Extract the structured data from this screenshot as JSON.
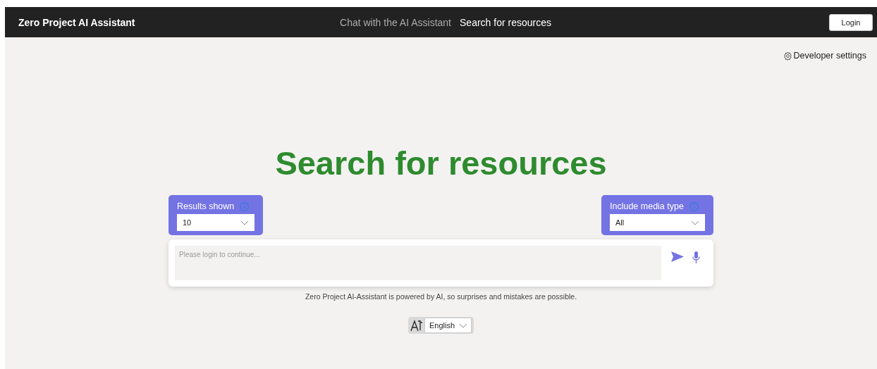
{
  "header": {
    "title": "Zero Project AI Assistant",
    "tabs": [
      {
        "label": "Chat with the AI Assistant",
        "selected": false
      },
      {
        "label": "Search for resources",
        "selected": true
      }
    ],
    "login_button": "Login"
  },
  "developer_settings": "Developer settings",
  "heading": "Search for resources",
  "filters": [
    {
      "label": "Results shown",
      "value": "10"
    },
    {
      "label": "Include media type",
      "value": "All"
    }
  ],
  "search": {
    "placeholder": "Please login to continue..."
  },
  "disclaimer": "Zero Project AI-Assistant is powered by AI, so surprises and mistakes are possible.",
  "language": {
    "value": "English"
  }
}
